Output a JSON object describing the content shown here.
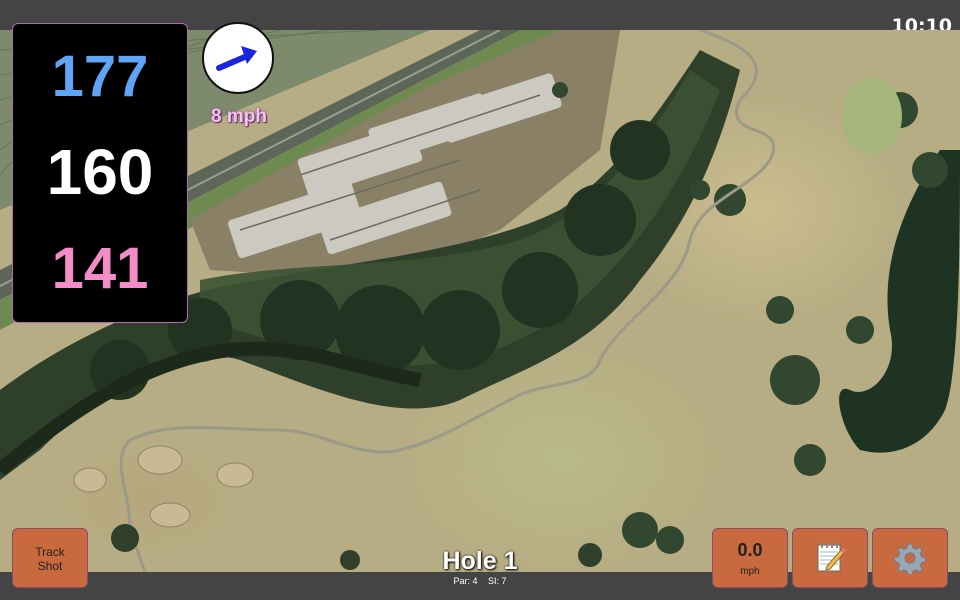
{
  "status_bar": {
    "time": "10:10"
  },
  "distances": {
    "back": "177",
    "middle": "160",
    "front": "141"
  },
  "wind": {
    "speed_label": "8 mph",
    "icon": "wind-direction-arrow-icon",
    "arrow_color": "#1a25e0"
  },
  "buttons": {
    "track_shot_line1": "Track",
    "track_shot_line2": "Shot",
    "speed_value": "0.0",
    "speed_unit": "mph",
    "notes_icon": "notepad-icon",
    "settings_icon": "gear-icon"
  },
  "hole": {
    "title": "Hole 1",
    "par": "Par: 4",
    "si": "SI: 7"
  },
  "colors": {
    "back_distance": "#5fa4f5",
    "middle_distance": "#ffffff",
    "front_distance": "#f48cc8",
    "button_bg": "#c86a3e"
  }
}
